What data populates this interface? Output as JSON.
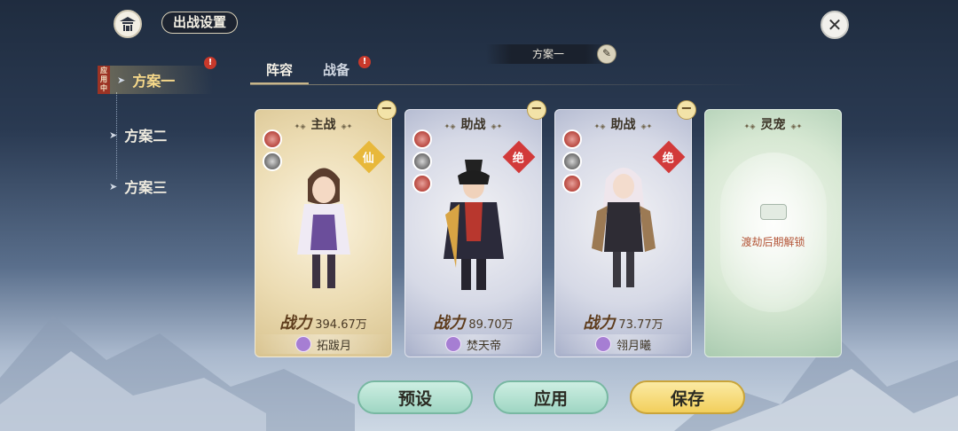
{
  "header": {
    "title": "出战设置"
  },
  "plan_bar": {
    "current_plan": "方案一"
  },
  "sidebar": {
    "in_use_badge": "应\n用\n中",
    "items": [
      {
        "label": "方案一",
        "active": true,
        "alert": "!"
      },
      {
        "label": "方案二",
        "active": false
      },
      {
        "label": "方案三",
        "active": false
      }
    ]
  },
  "tabs": [
    {
      "label": "阵容",
      "active": true
    },
    {
      "label": "战备",
      "active": false,
      "alert": "!"
    }
  ],
  "cards": [
    {
      "role": "主战",
      "rank_glyph": "仙",
      "power_label": "战力",
      "power_value": "394.67万",
      "name": "拓跋月"
    },
    {
      "role": "助战",
      "rank_glyph": "绝",
      "power_label": "战力",
      "power_value": "89.70万",
      "name": "焚天帝"
    },
    {
      "role": "助战",
      "rank_glyph": "绝",
      "power_label": "战力",
      "power_value": "73.77万",
      "name": "翎月曦"
    },
    {
      "role": "灵宠",
      "lock_text": "渡劫后期解锁"
    }
  ],
  "buttons": {
    "preset": "预设",
    "apply": "应用",
    "save": "保存"
  },
  "colors": {
    "gold_card": "#ecdcb3",
    "blue_card": "#d6d9e6",
    "green_card": "#d7e8d3",
    "alert_red": "#c8392b",
    "save_button": "#f2cf5c",
    "green_button": "#9fd6c3"
  },
  "icons": {
    "header": "pavilion-icon",
    "close": "close-icon",
    "edit": "edit-icon",
    "minus": "remove-icon",
    "lock": "lock-icon"
  }
}
